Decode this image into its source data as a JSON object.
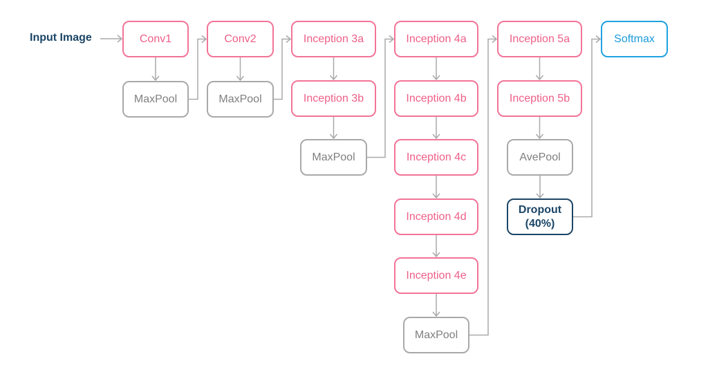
{
  "input_label": "Input Image",
  "colors": {
    "conv": "#f27497",
    "pool": "#a9a9a9",
    "dropout": "#1b4566",
    "softmax": "#1ea2e0",
    "wire": "#a9a9a9"
  },
  "nodes": [
    {
      "id": "conv1",
      "label": "Conv1",
      "kind": "conv"
    },
    {
      "id": "maxpool1",
      "label": "MaxPool",
      "kind": "pool"
    },
    {
      "id": "conv2",
      "label": "Conv2",
      "kind": "conv"
    },
    {
      "id": "maxpool2",
      "label": "MaxPool",
      "kind": "pool"
    },
    {
      "id": "inc3a",
      "label": "Inception 3a",
      "kind": "conv"
    },
    {
      "id": "inc3b",
      "label": "Inception 3b",
      "kind": "conv"
    },
    {
      "id": "maxpool3",
      "label": "MaxPool",
      "kind": "pool"
    },
    {
      "id": "inc4a",
      "label": "Inception 4a",
      "kind": "conv"
    },
    {
      "id": "inc4b",
      "label": "Inception 4b",
      "kind": "conv"
    },
    {
      "id": "inc4c",
      "label": "Inception 4c",
      "kind": "conv"
    },
    {
      "id": "inc4d",
      "label": "Inception 4d",
      "kind": "conv"
    },
    {
      "id": "inc4e",
      "label": "Inception 4e",
      "kind": "conv"
    },
    {
      "id": "maxpool4",
      "label": "MaxPool",
      "kind": "pool"
    },
    {
      "id": "inc5a",
      "label": "Inception 5a",
      "kind": "conv"
    },
    {
      "id": "inc5b",
      "label": "Inception 5b",
      "kind": "conv"
    },
    {
      "id": "avepool",
      "label": "AvePool",
      "kind": "pool"
    },
    {
      "id": "dropout",
      "label": "Dropout\n(40%)",
      "kind": "drop"
    },
    {
      "id": "softmax",
      "label": "Softmax",
      "kind": "out"
    }
  ],
  "edges": [
    [
      "input",
      "conv1"
    ],
    [
      "conv1",
      "maxpool1"
    ],
    [
      "maxpool1",
      "conv2"
    ],
    [
      "conv2",
      "maxpool2"
    ],
    [
      "maxpool2",
      "inc3a"
    ],
    [
      "inc3a",
      "inc3b"
    ],
    [
      "inc3b",
      "maxpool3"
    ],
    [
      "maxpool3",
      "inc4a"
    ],
    [
      "inc4a",
      "inc4b"
    ],
    [
      "inc4b",
      "inc4c"
    ],
    [
      "inc4c",
      "inc4d"
    ],
    [
      "inc4d",
      "inc4e"
    ],
    [
      "inc4e",
      "maxpool4"
    ],
    [
      "maxpool4",
      "inc5a"
    ],
    [
      "inc5a",
      "inc5b"
    ],
    [
      "inc5b",
      "avepool"
    ],
    [
      "avepool",
      "dropout"
    ],
    [
      "dropout",
      "softmax"
    ]
  ]
}
